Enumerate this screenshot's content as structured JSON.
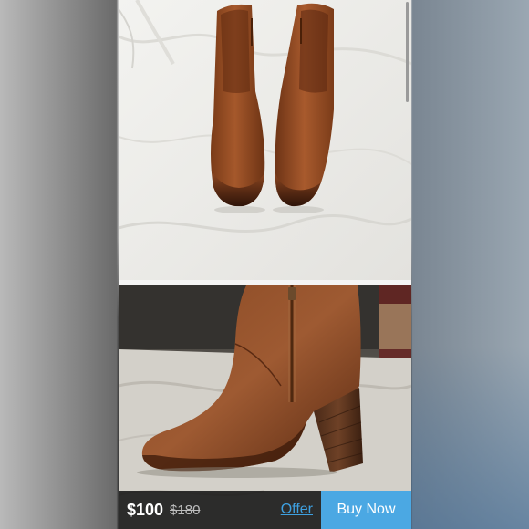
{
  "listing": {
    "price": "$100",
    "original_price": "$180",
    "offer_label": "Offer",
    "buy_now_label": "Buy Now"
  },
  "photos": [
    {
      "subject": "pair of brown leather ankle boots, front view on white fabric"
    },
    {
      "subject": "single brown leather ankle boot, side view with zipper and stacked heel"
    }
  ],
  "colors": {
    "accent": "#4ba8e3",
    "offer_link": "#3ea0e0",
    "price_bar_bg": "#141414",
    "leather": "#8a4a22"
  }
}
